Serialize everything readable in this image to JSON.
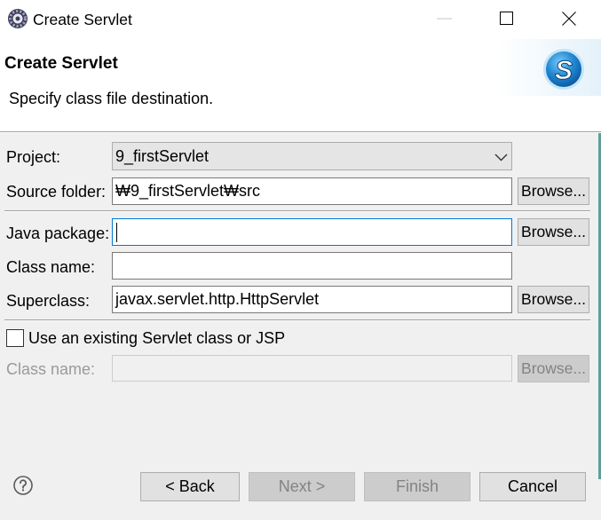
{
  "window": {
    "title": "Create Servlet",
    "icon": "eclipse-gear-icon"
  },
  "header": {
    "title": "Create Servlet",
    "description": "Specify class file destination.",
    "banner_icon": "servlet-wizard-icon",
    "banner_letter": "S"
  },
  "form": {
    "project": {
      "label": "Project:",
      "value": "9_firstServlet"
    },
    "source_folder": {
      "label": "Source folder:",
      "value": "₩9_firstServlet₩src",
      "browse_label": "Browse..."
    },
    "java_package": {
      "label": "Java package:",
      "value": "",
      "browse_label": "Browse...",
      "focused": true
    },
    "class_name": {
      "label": "Class name:",
      "value": ""
    },
    "superclass": {
      "label": "Superclass:",
      "value": "javax.servlet.http.HttpServlet",
      "browse_label": "Browse..."
    },
    "use_existing": {
      "label": "Use an existing Servlet class or JSP",
      "checked": false
    },
    "existing_class_name": {
      "label": "Class name:",
      "value": "",
      "browse_label": "Browse...",
      "enabled": false
    }
  },
  "buttons": {
    "help_icon": "help-icon",
    "back": "< Back",
    "next": "Next >",
    "next_enabled": false,
    "finish": "Finish",
    "finish_enabled": false,
    "cancel": "Cancel"
  },
  "colors": {
    "focus_border": "#0078d7",
    "dialog_background": "#f0f0f0",
    "disabled_text": "#838383"
  }
}
